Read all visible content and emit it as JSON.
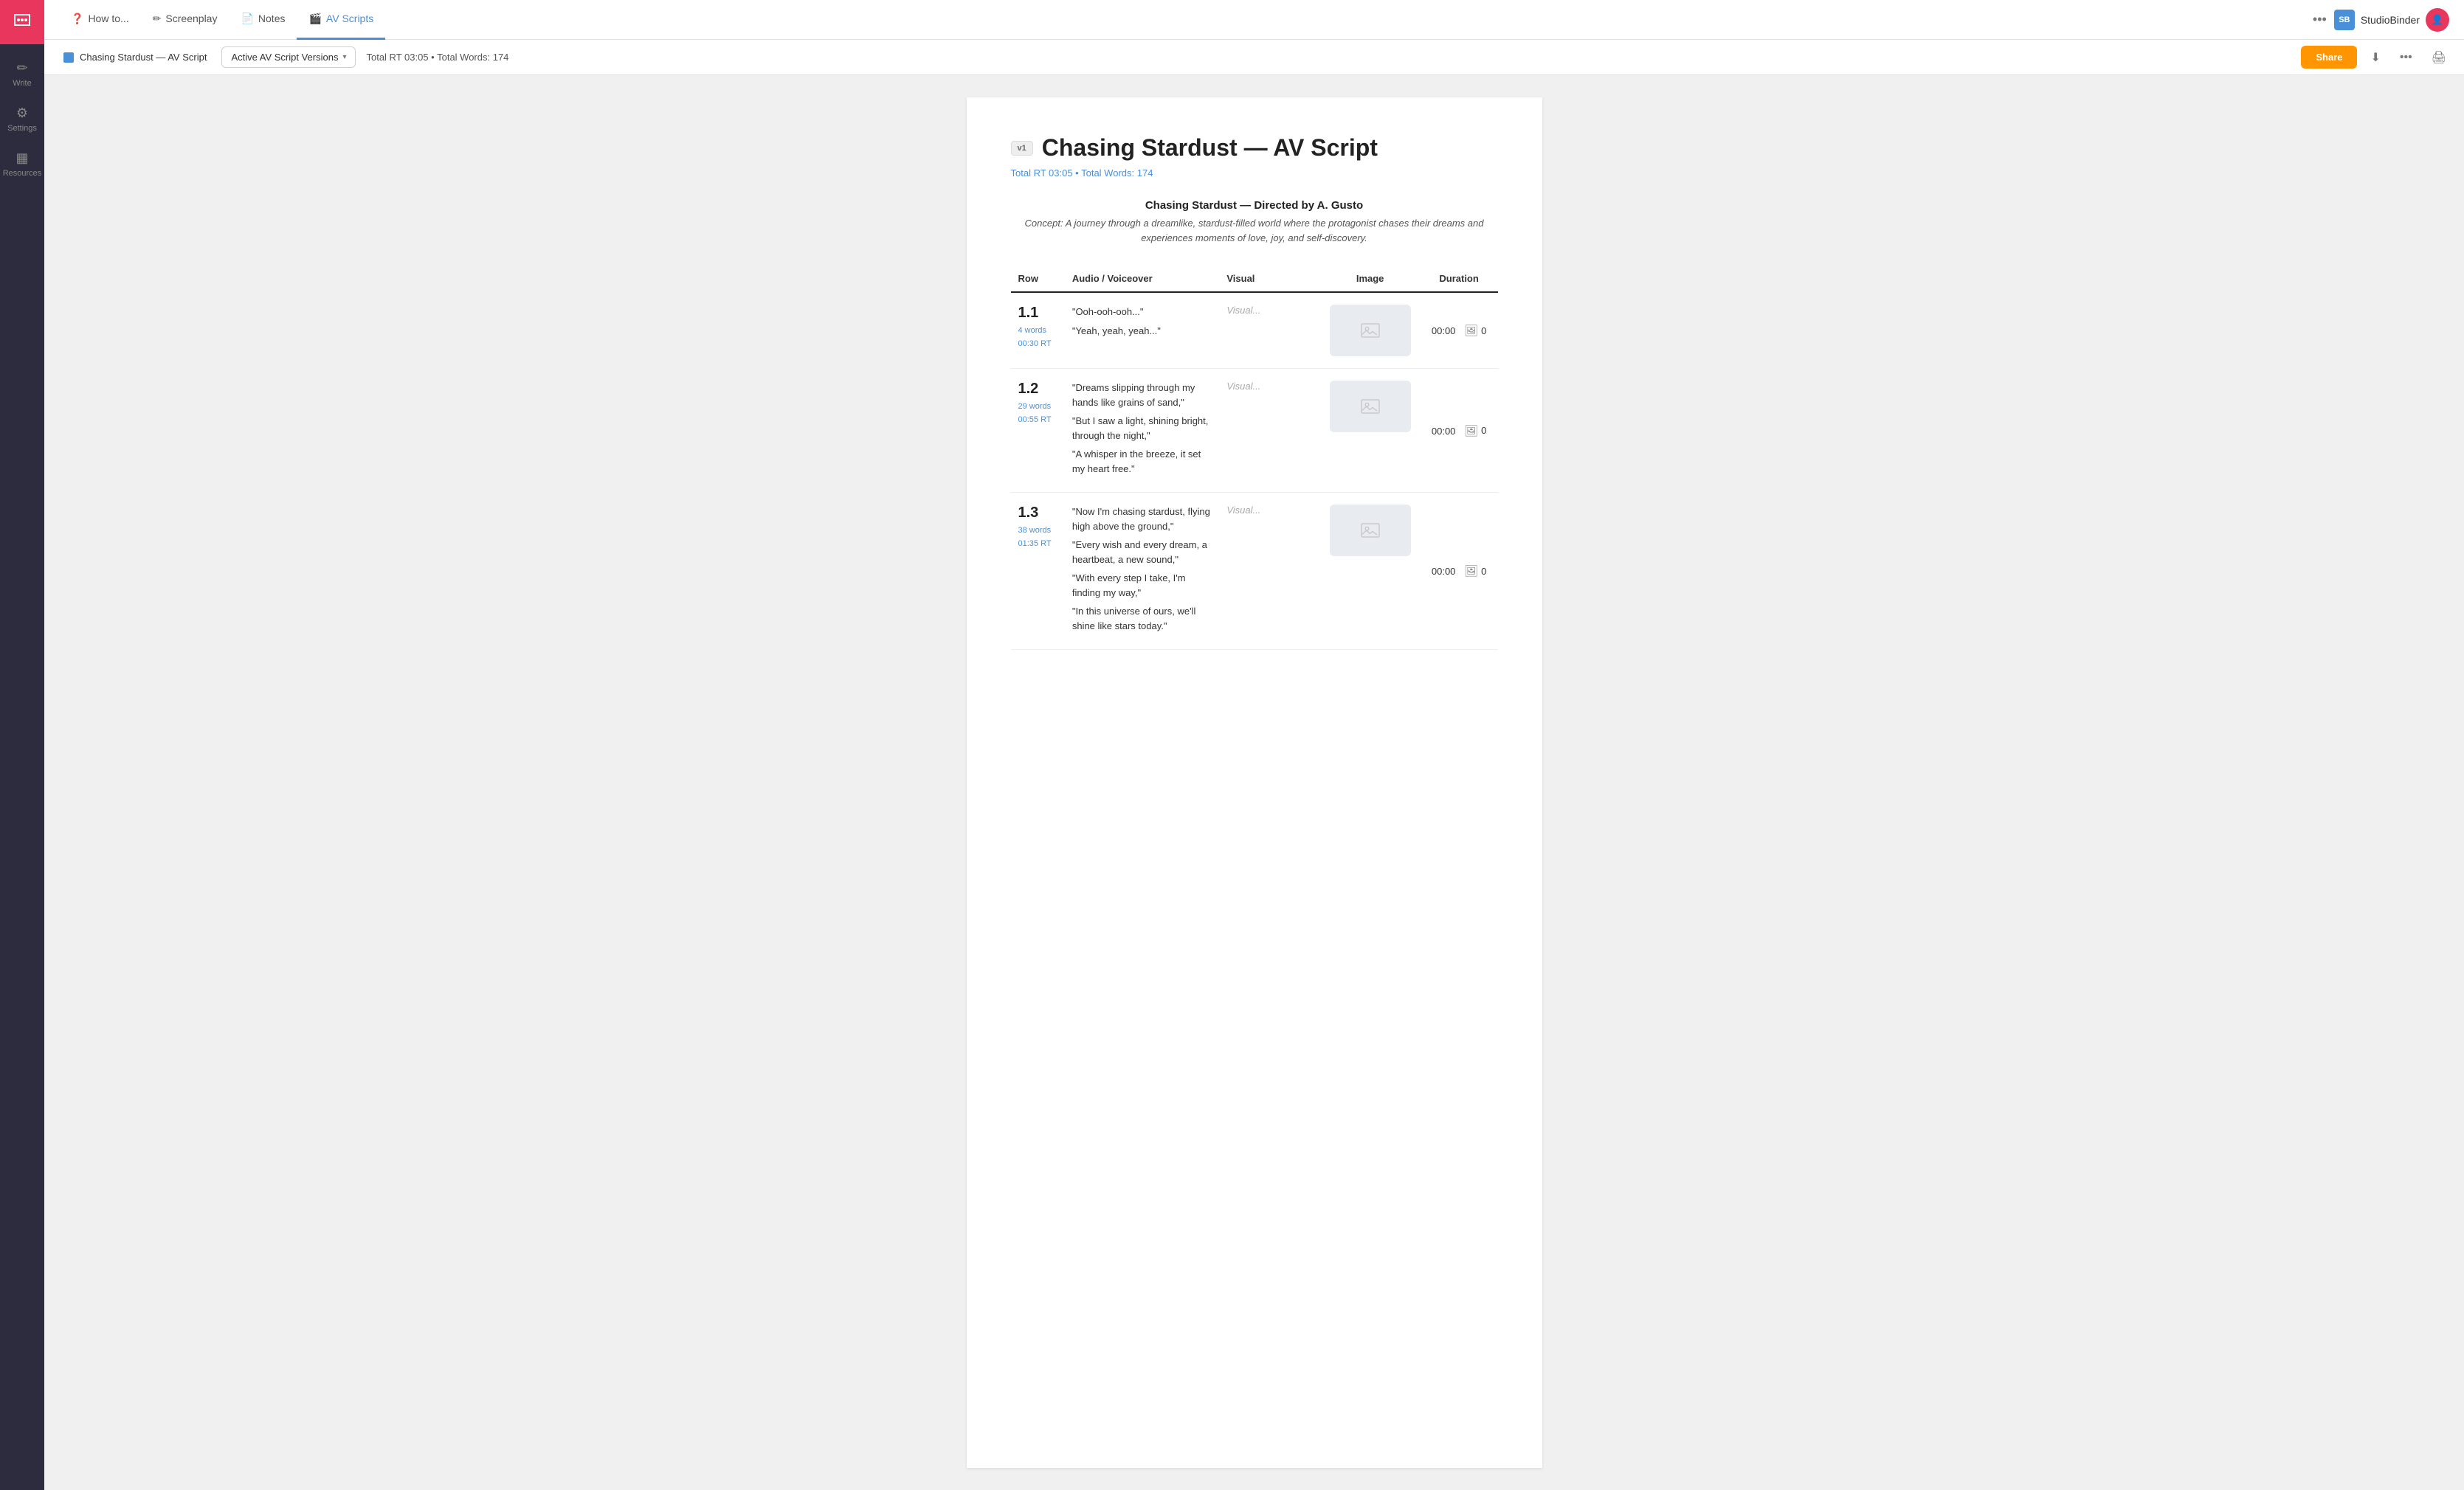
{
  "sidebar": {
    "logo_icon": "chat-icon",
    "nav_items": [
      {
        "id": "write",
        "label": "Write",
        "icon": "✏️"
      },
      {
        "id": "settings",
        "label": "Settings",
        "icon": "⚙️"
      },
      {
        "id": "resources",
        "label": "Resources",
        "icon": "📊"
      }
    ]
  },
  "top_nav": {
    "tabs": [
      {
        "id": "howto",
        "label": "How to...",
        "icon": "❓",
        "active": false
      },
      {
        "id": "screenplay",
        "label": "Screenplay",
        "icon": "✏️",
        "active": false
      },
      {
        "id": "notes",
        "label": "Notes",
        "icon": "📄",
        "active": false
      },
      {
        "id": "avscripts",
        "label": "AV Scripts",
        "icon": "🎬",
        "active": true
      }
    ],
    "more_icon": "•••",
    "brand": "StudioBinder",
    "user_initials": "SB"
  },
  "sub_toolbar": {
    "script_tab_label": "Chasing Stardust — AV Script",
    "versions_label": "Active AV Script Versions",
    "rt_words_info": "Total RT 03:05 • Total Words: 174",
    "share_label": "Share"
  },
  "document": {
    "version_badge": "v1",
    "title": "Chasing Stardust — AV Script",
    "rt_info": "Total RT 03:05 • Total Words: 174",
    "directed_by": "Chasing Stardust — Directed by A. Gusto",
    "concept": "Concept: A journey through a dreamlike, stardust-filled world where the protagonist chases their dreams and experiences moments of love, joy, and self-discovery.",
    "table": {
      "headers": [
        "Row",
        "Audio / Voiceover",
        "Visual",
        "Image",
        "Duration"
      ],
      "rows": [
        {
          "row_num": "1.1",
          "words": "4 words",
          "rt": "00:30 RT",
          "audio": [
            "\"Ooh-ooh-ooh...\"",
            "\"Yeah, yeah, yeah...\""
          ],
          "visual": "Visual...",
          "has_image": true,
          "duration": "00:00",
          "media_count": "0"
        },
        {
          "row_num": "1.2",
          "words": "29 words",
          "rt": "00:55 RT",
          "audio": [
            "\"Dreams slipping through my hands like grains of sand,\"",
            "\"But I saw a light, shining bright, through the night,\"",
            "\"A whisper in the breeze, it set my heart free.\""
          ],
          "visual": "Visual...",
          "has_image": true,
          "duration": "00:00",
          "media_count": "0"
        },
        {
          "row_num": "1.3",
          "words": "38 words",
          "rt": "01:35 RT",
          "audio": [
            "\"Now I'm chasing stardust, flying high above the ground,\"",
            "\"Every wish and every dream, a heartbeat, a new sound,\"",
            "\"With every step I take, I'm finding my way,\"",
            "\"In this universe of ours, we'll shine like stars today.\""
          ],
          "visual": "Visual...",
          "has_image": true,
          "duration": "00:00",
          "media_count": "0"
        }
      ]
    }
  }
}
